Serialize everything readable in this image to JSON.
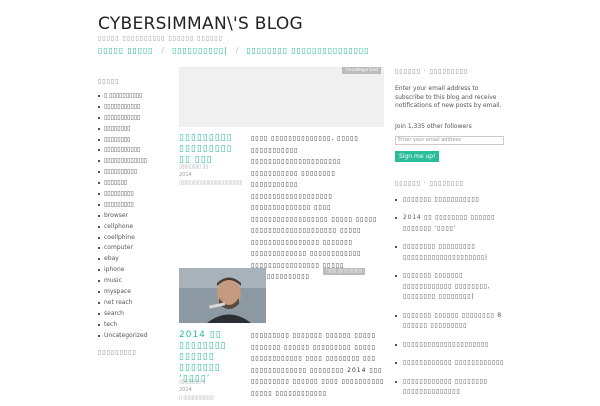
{
  "site": {
    "title": "CYBERSIMMAN\\'S BLOG",
    "tagline": "▯▯▯▯▯ ▯▯▯▯▯▯▯▯▯▯ ▯▯▯▯▯▯ ▯▯▯▯▯▯"
  },
  "nav": {
    "items": [
      "▯▯▯▯▯ ▯▯▯▯▯",
      "▯▯▯▯▯▯▯▯▯▯|",
      "▯▯▯▯▯▯▯▯ ▯▯▯▯▯▯▯▯▯▯▯▯▯▯▯"
    ]
  },
  "left_sidebar": {
    "title": "▯▯▯▯▯",
    "categories": [
      "▯ ▯▯▯▯▯▯▯▯▯▯",
      "▯▯▯▯▯▯▯▯▯▯▯",
      "▯▯▯▯▯▯▯▯▯▯▯",
      "▯▯▯▯▯▯▯▯",
      "▯▯▯▯▯▯▯▯",
      "▯▯▯▯▯▯▯▯▯▯▯",
      "▯▯▯▯▯▯▯▯▯▯▯▯▯",
      "▯▯▯▯▯▯▯▯▯▯",
      "▯▯▯▯▯▯▯",
      "▯▯▯▯▯▯▯▯▯",
      "▯▯▯▯▯▯▯▯▯",
      "browser",
      "cellphone",
      "coellphine",
      "computer",
      "ebay",
      "iphone",
      "music",
      "myspace",
      "net reach",
      "search",
      "tech",
      "Uncategorized"
    ],
    "second_title": "▯▯▯▯▯▯▯▯▯"
  },
  "posts": [
    {
      "category": "Uncategorized",
      "title": "▯▯▯▯▯▯▯▯▯ ▯▯▯▯▯▯▯▯▯ ▯▯ ▯▯▯",
      "meta_line1": "▯▯▯▯▯▯▯▯ ▯▯",
      "meta_year": "2014",
      "meta_line2": "▯▯▯▯▯▯▯▯▯▯▯▯▯▯▯▯▯▯▯▯▯▯▯",
      "body": "▯▯▯▯ ▯▯▯▯▯▯▯▯▯▯▯▯▯▯, ▯▯▯▯▯ ▯▯▯▯▯▯▯▯▯▯▯ ▯▯▯▯▯▯▯▯▯▯▯▯▯▯▯▯▯▯▯▯▯ ▯▯▯▯▯▯▯▯▯▯▯ ▯▯▯▯▯▯▯▯ ▯▯▯▯▯▯▯▯▯▯▯ ▯▯▯▯▯▯▯▯▯▯▯▯▯▯▯▯▯▯▯ ▯▯▯▯▯▯▯▯▯▯▯▯▯▯ ▯▯▯▯ ▯▯▯▯▯▯▯▯▯▯▯▯▯▯▯▯▯▯ ▯▯▯▯▯ ▯▯▯▯▯ ▯▯▯▯▯▯▯▯▯▯▯▯▯▯▯▯▯▯▯▯ ▯▯▯▯▯ ▯▯▯▯▯▯▯▯▯▯▯▯▯▯▯▯ ▯▯▯▯▯▯▯ ▯▯▯▯▯▯▯▯▯▯▯▯▯ ▯▯▯▯▯▯▯▯▯▯▯▯ ▯▯▯▯▯▯▯▯▯▯▯▯▯▯▯▯ ▯▯▯▯▯ ,▯▯▯▯▯▯▯▯▯▯▯▯▯"
    },
    {
      "category": "▯▯▯▯ ▯▯▯▯▯▯▯▯▯▯",
      "title": "2014 ▯▯ ▯▯▯▯▯▯▯▯ ▯▯▯▯▯▯ ▯▯▯▯▯▯▯ ‘▯▯▯▯’",
      "meta_line1": "▯▯▯▯▯▯▯▯ ▯",
      "meta_year": "2014",
      "meta_line2": "▯ ▯▯▯▯▯▯▯▯▯▯▯",
      "body_pre": "▯▯▯▯▯▯▯▯▯ ▯▯▯▯▯▯▯ ▯▯▯▯▯▯ ▯▯▯▯▯ ▯▯▯▯▯▯▯ ▯▯▯▯▯▯ ▯▯▯▯▯▯▯▯▯ ▯▯▯▯▯ ▯▯▯▯▯▯▯▯▯▯▯▯ ▯▯▯▯ ▯▯▯▯▯▯▯▯ ▯▯▯ ▯▯▯▯▯▯▯▯▯▯▯▯▯ ▯▯▯▯▯▯▯▯ ",
      "body_year": "2014",
      "body_post": " ▯▯▯ ▯▯▯▯▯▯▯▯▯ ▯▯▯▯▯▯ ▯▯▯▯ ▯▯▯▯▯▯▯▯▯▯ ▯▯▯▯▯ ▯▯▯▯▯▯▯▯▯▯▯▯"
    }
  ],
  "right_sidebar": {
    "follow_title": "▯▯▯▯▯▯ · ▯▯▯▯▯▯▯▯▯",
    "subscribe_text": "Enter your email address to subscribe to this blog and receive notifications of new posts by email.",
    "followers": "Join 1,335 other followers",
    "email_placeholder": "Enter your email address",
    "signup_label": "Sign me up!",
    "recent_title": "▯▯▯▯▯▯ · ▯▯▯▯▯▯▯▯",
    "recent_posts": [
      "▯▯▯▯▯▯▯ ▯▯▯▯▯▯▯▯▯▯▯",
      "2014 ▯▯ ▯▯▯▯▯▯▯▯ ▯▯▯▯▯▯ ▯▯▯▯▯▯▯ ‘▯▯▯▯’",
      "▯▯▯▯▯▯▯▯ ▯▯▯▯▯▯▯▯▯ ▯▯▯▯▯▯▯▯▯▯▯▯▯▯▯▯▯▯▯▯|",
      "▯▯▯▯▯▯▯ ▯▯▯▯▯▯▯ ▯▯▯▯▯▯▯▯▯▯▯▯ ▯▯▯▯▯▯▯▯, ▯▯▯▯▯▯▯▯ ▯▯▯▯▯▯▯▯|",
      "▯▯▯▯▯▯▯ ▯▯▯▯▯▯ ▯▯▯▯▯▯▯▯ 8 ▯▯▯▯▯▯ ▯▯▯▯▯▯▯▯▯",
      "▯▯▯▯▯▯▯▯▯▯▯▯▯▯▯▯▯▯▯▯▯",
      "▯▯▯▯▯▯▯▯▯▯▯▯ ▯▯▯▯▯▯▯▯▯▯▯▯",
      "▯▯▯▯▯▯▯▯▯▯▯▯ ▯▯▯▯▯▯▯▯ ▯▯▯▯▯▯▯▯▯▯▯▯▯▯"
    ]
  },
  "colors": {
    "accent": "#2bbc9a",
    "badge": "#bbbbbb"
  }
}
